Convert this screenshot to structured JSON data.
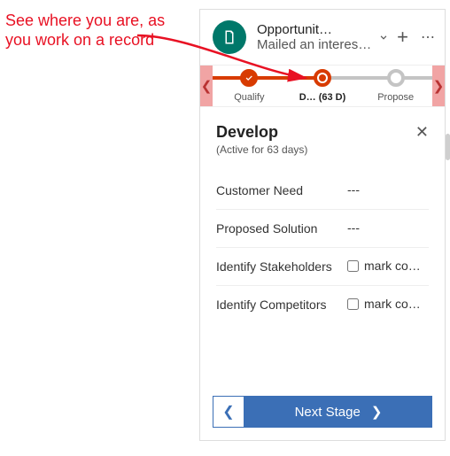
{
  "annotation": "See where you are, as you work on a record",
  "header": {
    "title": "Opportunit…",
    "subtitle": "Mailed an interes…"
  },
  "stages": {
    "items": [
      {
        "label": "Qualify"
      },
      {
        "label": "D…  (63 D)"
      },
      {
        "label": "Propose"
      }
    ]
  },
  "detail": {
    "title": "Develop",
    "subtitle": "(Active for 63 days)"
  },
  "fields": [
    {
      "label": "Customer Need",
      "value": "---",
      "checkbox": false
    },
    {
      "label": "Proposed Solution",
      "value": "---",
      "checkbox": false
    },
    {
      "label": "Identify Stakeholders",
      "value": "mark co…",
      "checkbox": true
    },
    {
      "label": "Identify Competitors",
      "value": "mark co…",
      "checkbox": true
    }
  ],
  "footer": {
    "next": "Next Stage"
  }
}
